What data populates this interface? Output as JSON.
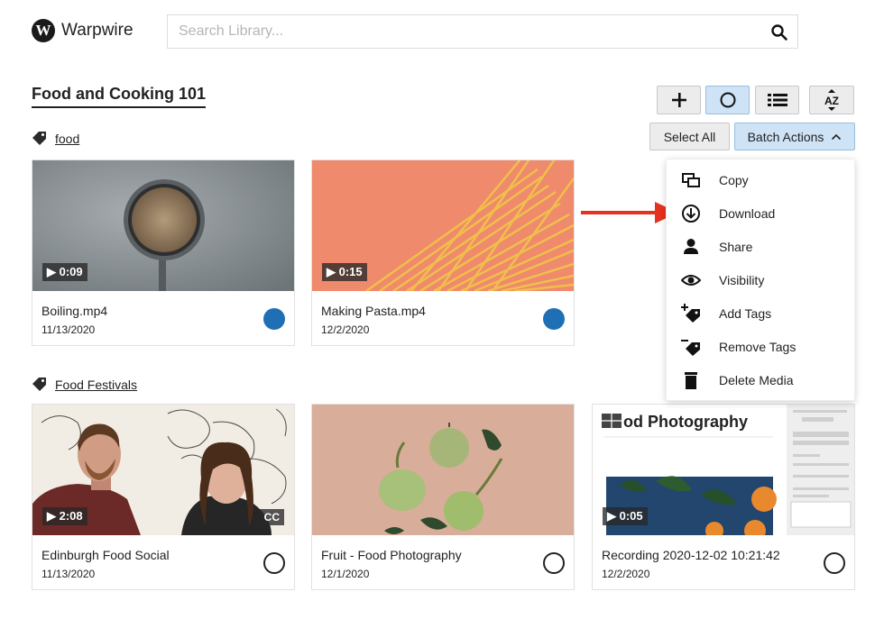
{
  "header": {
    "brand": "Warpwire",
    "logo_letter": "W",
    "search_placeholder": "Search Library..."
  },
  "collection": {
    "title": "Food and Cooking 101"
  },
  "toolbar": {
    "buttons": [
      "plus-icon",
      "circle-icon",
      "list-icon",
      "sort-az-icon"
    ],
    "sort_label": "AZ",
    "select_all": "Select All",
    "batch_actions": "Batch Actions"
  },
  "sections": [
    {
      "label": "food",
      "cards": [
        {
          "title": "Boiling.mp4",
          "date": "11/13/2020",
          "duration": "▶ 0:09",
          "selected": true
        },
        {
          "title": "Making Pasta.mp4",
          "date": "12/2/2020",
          "duration": "▶ 0:15",
          "selected": true
        }
      ]
    },
    {
      "label": "Food Festivals",
      "cards": [
        {
          "title": "Edinburgh Food Social",
          "date": "11/13/2020",
          "duration": "▶ 2:08",
          "cc": "CC",
          "selected": false
        },
        {
          "title": "Fruit - Food Photography",
          "date": "12/1/2020",
          "selected": false
        },
        {
          "title": "Recording 2020-12-02 10:21:42",
          "date": "12/2/2020",
          "duration": "▶ 0:05",
          "thumb_text": "od Photography",
          "selected": false
        }
      ]
    }
  ],
  "batch_menu": {
    "items": [
      {
        "label": "Copy",
        "icon": "copy-icon"
      },
      {
        "label": "Download",
        "icon": "download-icon"
      },
      {
        "label": "Share",
        "icon": "person-icon"
      },
      {
        "label": "Visibility",
        "icon": "eye-icon"
      },
      {
        "label": "Add Tags",
        "icon": "add-tag-icon"
      },
      {
        "label": "Remove Tags",
        "icon": "remove-tag-icon"
      },
      {
        "label": "Delete Media",
        "icon": "trash-icon"
      }
    ]
  },
  "colors": {
    "accent": "#1f6fb5",
    "active_button": "#cfe3f7",
    "arrow": "#e5321e"
  }
}
